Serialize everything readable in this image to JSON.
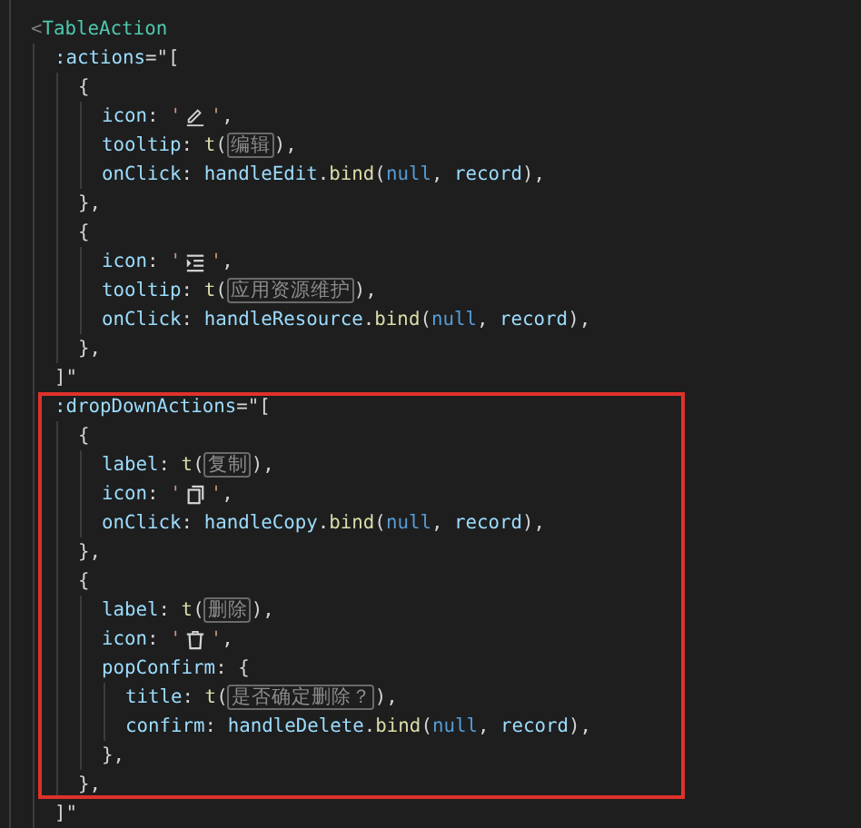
{
  "editor": {
    "lines": [
      {
        "tokens": [
          {
            "kind": "punct",
            "text": "<"
          },
          {
            "kind": "tagname",
            "text": "TableAction"
          }
        ],
        "children": [
          {
            "tokens": [
              {
                "kind": "attr",
                "text": ":actions"
              },
              {
                "kind": "plain",
                "text": "=\"["
              }
            ],
            "children": [
              {
                "tokens": [
                  {
                    "kind": "plain",
                    "text": "{"
                  }
                ],
                "children": [
                  {
                    "tokens": [
                      {
                        "kind": "variable",
                        "text": "icon"
                      },
                      {
                        "kind": "plain",
                        "text": ": "
                      },
                      {
                        "kind": "string",
                        "text": "'"
                      },
                      {
                        "kind": "pencil"
                      },
                      {
                        "kind": "string",
                        "text": "'"
                      },
                      {
                        "kind": "plain",
                        "text": ","
                      }
                    ]
                  },
                  {
                    "tokens": [
                      {
                        "kind": "variable",
                        "text": "tooltip"
                      },
                      {
                        "kind": "plain",
                        "text": ": "
                      },
                      {
                        "kind": "func",
                        "text": "t"
                      },
                      {
                        "kind": "plain",
                        "text": "("
                      },
                      {
                        "kind": "hint",
                        "text": "编辑"
                      },
                      {
                        "kind": "plain",
                        "text": "),"
                      }
                    ]
                  },
                  {
                    "tokens": [
                      {
                        "kind": "variable",
                        "text": "onClick"
                      },
                      {
                        "kind": "plain",
                        "text": ": "
                      },
                      {
                        "kind": "variable",
                        "text": "handleEdit"
                      },
                      {
                        "kind": "plain",
                        "text": "."
                      },
                      {
                        "kind": "func",
                        "text": "bind"
                      },
                      {
                        "kind": "plain",
                        "text": "("
                      },
                      {
                        "kind": "constant",
                        "text": "null"
                      },
                      {
                        "kind": "plain",
                        "text": ", "
                      },
                      {
                        "kind": "variable",
                        "text": "record"
                      },
                      {
                        "kind": "plain",
                        "text": "),"
                      }
                    ]
                  }
                ]
              },
              {
                "tokens": [
                  {
                    "kind": "plain",
                    "text": "},"
                  }
                ]
              },
              {
                "tokens": [
                  {
                    "kind": "plain",
                    "text": "{"
                  }
                ],
                "children": [
                  {
                    "tokens": [
                      {
                        "kind": "variable",
                        "text": "icon"
                      },
                      {
                        "kind": "plain",
                        "text": ": "
                      },
                      {
                        "kind": "string",
                        "text": "'"
                      },
                      {
                        "kind": "list"
                      },
                      {
                        "kind": "string",
                        "text": "'"
                      },
                      {
                        "kind": "plain",
                        "text": ","
                      }
                    ]
                  },
                  {
                    "tokens": [
                      {
                        "kind": "variable",
                        "text": "tooltip"
                      },
                      {
                        "kind": "plain",
                        "text": ": "
                      },
                      {
                        "kind": "func",
                        "text": "t"
                      },
                      {
                        "kind": "plain",
                        "text": "("
                      },
                      {
                        "kind": "hint",
                        "text": "应用资源维护"
                      },
                      {
                        "kind": "plain",
                        "text": "),"
                      }
                    ]
                  },
                  {
                    "tokens": [
                      {
                        "kind": "variable",
                        "text": "onClick"
                      },
                      {
                        "kind": "plain",
                        "text": ": "
                      },
                      {
                        "kind": "variable",
                        "text": "handleResource"
                      },
                      {
                        "kind": "plain",
                        "text": "."
                      },
                      {
                        "kind": "func",
                        "text": "bind"
                      },
                      {
                        "kind": "plain",
                        "text": "("
                      },
                      {
                        "kind": "constant",
                        "text": "null"
                      },
                      {
                        "kind": "plain",
                        "text": ", "
                      },
                      {
                        "kind": "variable",
                        "text": "record"
                      },
                      {
                        "kind": "plain",
                        "text": "),"
                      }
                    ]
                  }
                ]
              },
              {
                "tokens": [
                  {
                    "kind": "plain",
                    "text": "},"
                  }
                ]
              }
            ]
          },
          {
            "tokens": [
              {
                "kind": "plain",
                "text": "]\""
              }
            ]
          },
          {
            "highlighted": true,
            "tokens": [
              {
                "kind": "attr",
                "text": ":dropDownActions"
              },
              {
                "kind": "plain",
                "text": "=\"["
              }
            ],
            "children": [
              {
                "tokens": [
                  {
                    "kind": "plain",
                    "text": "{"
                  }
                ],
                "children": [
                  {
                    "tokens": [
                      {
                        "kind": "variable",
                        "text": "label"
                      },
                      {
                        "kind": "plain",
                        "text": ": "
                      },
                      {
                        "kind": "func",
                        "text": "t"
                      },
                      {
                        "kind": "plain",
                        "text": "("
                      },
                      {
                        "kind": "hint",
                        "text": "复制"
                      },
                      {
                        "kind": "plain",
                        "text": "),"
                      }
                    ]
                  },
                  {
                    "tokens": [
                      {
                        "kind": "variable",
                        "text": "icon"
                      },
                      {
                        "kind": "plain",
                        "text": ": "
                      },
                      {
                        "kind": "string",
                        "text": "'"
                      },
                      {
                        "kind": "copy"
                      },
                      {
                        "kind": "string",
                        "text": "'"
                      },
                      {
                        "kind": "plain",
                        "text": ","
                      }
                    ]
                  },
                  {
                    "tokens": [
                      {
                        "kind": "variable",
                        "text": "onClick"
                      },
                      {
                        "kind": "plain",
                        "text": ": "
                      },
                      {
                        "kind": "variable",
                        "text": "handleCopy"
                      },
                      {
                        "kind": "plain",
                        "text": "."
                      },
                      {
                        "kind": "func",
                        "text": "bind"
                      },
                      {
                        "kind": "plain",
                        "text": "("
                      },
                      {
                        "kind": "constant",
                        "text": "null"
                      },
                      {
                        "kind": "plain",
                        "text": ", "
                      },
                      {
                        "kind": "variable",
                        "text": "record"
                      },
                      {
                        "kind": "plain",
                        "text": "),"
                      }
                    ]
                  }
                ]
              },
              {
                "tokens": [
                  {
                    "kind": "plain",
                    "text": "},"
                  }
                ]
              },
              {
                "tokens": [
                  {
                    "kind": "plain",
                    "text": "{"
                  }
                ],
                "children": [
                  {
                    "tokens": [
                      {
                        "kind": "variable",
                        "text": "label"
                      },
                      {
                        "kind": "plain",
                        "text": ": "
                      },
                      {
                        "kind": "func",
                        "text": "t"
                      },
                      {
                        "kind": "plain",
                        "text": "("
                      },
                      {
                        "kind": "hint",
                        "text": "删除"
                      },
                      {
                        "kind": "plain",
                        "text": "),"
                      }
                    ]
                  },
                  {
                    "tokens": [
                      {
                        "kind": "variable",
                        "text": "icon"
                      },
                      {
                        "kind": "plain",
                        "text": ": "
                      },
                      {
                        "kind": "string",
                        "text": "'"
                      },
                      {
                        "kind": "trash"
                      },
                      {
                        "kind": "string",
                        "text": "'"
                      },
                      {
                        "kind": "plain",
                        "text": ","
                      }
                    ]
                  },
                  {
                    "tokens": [
                      {
                        "kind": "variable",
                        "text": "popConfirm"
                      },
                      {
                        "kind": "plain",
                        "text": ": {"
                      }
                    ],
                    "children": [
                      {
                        "tokens": [
                          {
                            "kind": "variable",
                            "text": "title"
                          },
                          {
                            "kind": "plain",
                            "text": ": "
                          },
                          {
                            "kind": "func",
                            "text": "t"
                          },
                          {
                            "kind": "plain",
                            "text": "("
                          },
                          {
                            "kind": "hint",
                            "text": "是否确定删除？"
                          },
                          {
                            "kind": "plain",
                            "text": "),"
                          }
                        ]
                      },
                      {
                        "tokens": [
                          {
                            "kind": "variable",
                            "text": "confirm"
                          },
                          {
                            "kind": "plain",
                            "text": ": "
                          },
                          {
                            "kind": "variable",
                            "text": "handleDelete"
                          },
                          {
                            "kind": "plain",
                            "text": "."
                          },
                          {
                            "kind": "func",
                            "text": "bind"
                          },
                          {
                            "kind": "plain",
                            "text": "("
                          },
                          {
                            "kind": "constant",
                            "text": "null"
                          },
                          {
                            "kind": "plain",
                            "text": ", "
                          },
                          {
                            "kind": "variable",
                            "text": "record"
                          },
                          {
                            "kind": "plain",
                            "text": "),"
                          }
                        ]
                      }
                    ]
                  },
                  {
                    "tokens": [
                      {
                        "kind": "plain",
                        "text": "},"
                      }
                    ]
                  }
                ]
              },
              {
                "tokens": [
                  {
                    "kind": "plain",
                    "text": "},"
                  }
                ]
              }
            ]
          },
          {
            "tokens": [
              {
                "kind": "plain",
                "text": "]\""
              }
            ]
          }
        ]
      }
    ]
  }
}
